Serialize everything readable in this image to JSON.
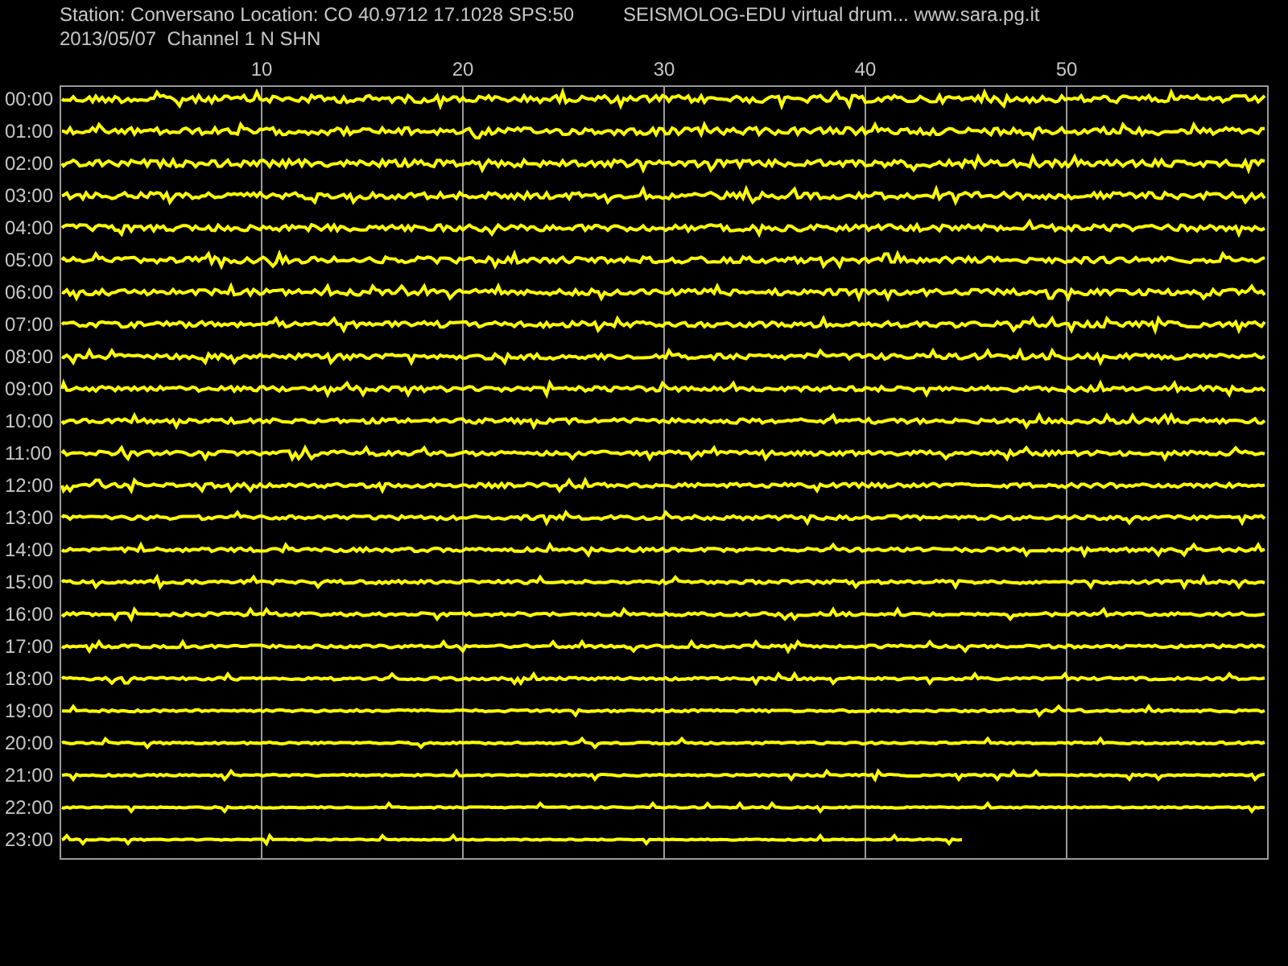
{
  "header": {
    "station": "Station: Conversano Location: CO 40.9712 17.1028 SPS:50",
    "title": "SEISMOLOG-EDU virtual drum... www.sara.pg.it",
    "subtitle": "2013/05/07  Channel 1 N SHN"
  },
  "minute_ticks": [
    "10",
    "20",
    "30",
    "40",
    "50"
  ],
  "rows": [
    {
      "label": "00:00",
      "level": 1
    },
    {
      "label": "01:00",
      "level": 1
    },
    {
      "label": "02:00",
      "level": 1
    },
    {
      "label": "03:00",
      "level": 1
    },
    {
      "label": "04:00",
      "level": 1
    },
    {
      "label": "05:00",
      "level": 1
    },
    {
      "label": "06:00",
      "level": 1
    },
    {
      "label": "07:00",
      "level": 1
    },
    {
      "label": "08:00",
      "level": 1
    },
    {
      "label": "09:00",
      "level": 1
    },
    {
      "label": "10:00",
      "level": 1
    },
    {
      "label": "11:00",
      "level": 1
    },
    {
      "label": "12:00",
      "level": 1
    },
    {
      "label": "13:00",
      "level": 1
    },
    {
      "label": "14:00",
      "level": 1
    },
    {
      "label": "15:00",
      "level": 1
    },
    {
      "label": "16:00",
      "level": 1
    },
    {
      "label": "17:00",
      "level": 1
    },
    {
      "label": "18:00",
      "level": 1
    },
    {
      "label": "19:00",
      "level": 1
    },
    {
      "label": "20:00",
      "level": 1
    },
    {
      "label": "21:00",
      "level": 1
    },
    {
      "label": "22:00",
      "level": 1
    },
    {
      "label": "23:00",
      "level": 0.75
    }
  ]
}
